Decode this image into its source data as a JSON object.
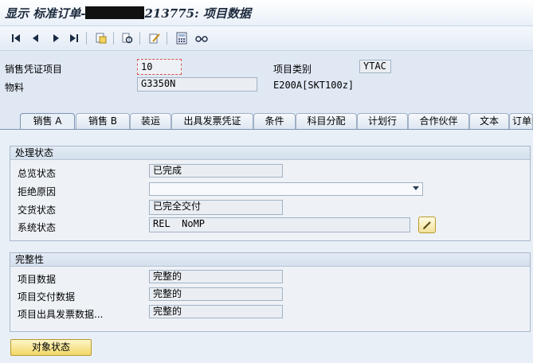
{
  "title": {
    "prefix": "显示 标准订单-",
    "suffix": "213775: 项目数据"
  },
  "toolbar": {
    "items": [
      {
        "name": "first-page-icon",
        "glyph": "⏮"
      },
      {
        "name": "previous-page-icon",
        "glyph": "◀"
      },
      {
        "name": "next-page-icon",
        "glyph": "▶"
      },
      {
        "name": "last-page-icon",
        "glyph": "⏭"
      }
    ]
  },
  "header": {
    "item_label": "销售凭证项目",
    "item_value": "10",
    "category_label": "项目类别",
    "category_value": "YTAC",
    "material_label": "物料",
    "material_value": "G3350N",
    "material_desc": "E200A[SKT100z]"
  },
  "tabs": [
    "销售 A",
    "销售 B",
    "装运",
    "出具发票凭证",
    "条件",
    "科目分配",
    "计划行",
    "合作伙伴",
    "文本",
    "订单数据"
  ],
  "processing": {
    "title": "处理状态",
    "overall_label": "总览状态",
    "overall_value": "已完成",
    "rejection_label": "拒绝原因",
    "rejection_value": "",
    "delivery_label": "交货状态",
    "delivery_value": "已完全交付",
    "system_label": "系统状态",
    "system_value": "REL  NoMP"
  },
  "completeness": {
    "title": "完整性",
    "item_data_label": "项目数据",
    "item_data_value": "完整的",
    "item_delivery_label": "项目交付数据",
    "item_delivery_value": "完整的",
    "item_billing_label": "项目出具发票数据...",
    "item_billing_value": "完整的"
  },
  "object_status_button": "对象状态",
  "colors": {
    "accent_button": "#f1d766",
    "panel": "#e9eff7",
    "focus_border": "#d9534f"
  }
}
